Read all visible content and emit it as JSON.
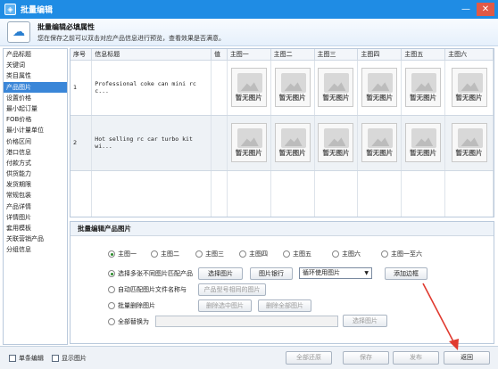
{
  "window": {
    "title": "批量编辑"
  },
  "banner": {
    "title": "批量编辑必填属性",
    "description": "您在保存之前可以双击对应产品信息进行预览，查看效果是否满意。"
  },
  "sidebar": {
    "items": [
      {
        "label": "产品标题"
      },
      {
        "label": "关键词"
      },
      {
        "label": "类目属性"
      },
      {
        "label": "产品图片",
        "active": true
      },
      {
        "label": "设置价格"
      },
      {
        "label": "最小起订量"
      },
      {
        "label": "FOB价格"
      },
      {
        "label": "最小计量单位"
      },
      {
        "label": "价格区间"
      },
      {
        "label": "港口信息"
      },
      {
        "label": "付款方式"
      },
      {
        "label": "供货能力"
      },
      {
        "label": "发货期限"
      },
      {
        "label": "常规包装"
      },
      {
        "label": "产品详情"
      },
      {
        "label": "详情图片"
      },
      {
        "label": "套用模板"
      },
      {
        "label": "关联营销产品"
      },
      {
        "label": "分组信息"
      }
    ]
  },
  "grid": {
    "columns": [
      "序号",
      "信息标题",
      "值",
      "主图一",
      "主图二",
      "主图三",
      "主图四",
      "主图五",
      "主图六"
    ],
    "rows": [
      {
        "index": "1",
        "title": "Professional coke can mini rc c..."
      },
      {
        "index": "2",
        "title": "Hot selling rc car turbo kit wi..."
      }
    ],
    "no_image_label": "暂无图片"
  },
  "panel": {
    "title": "批量编辑产品图片",
    "image_radios": [
      "主图一",
      "主图二",
      "主图三",
      "主图四",
      "主图五",
      "主图六",
      "主图一至六"
    ],
    "options": {
      "select_local": "选择多张不同图片匹配产品",
      "auto_match": "自动匹配图片文件名称与",
      "batch_delete": "批量删除图片",
      "replace_all": "全部替换为"
    },
    "buttons": {
      "choose_image": "选择图片",
      "image_bank": "图片银行",
      "add_border": "添加边框",
      "model_match": "产品型号相同的图片",
      "delete_selected": "删除选中图片",
      "delete_all": "删除全部图片",
      "choose_image2": "选择图片"
    },
    "loop_select": {
      "value": "循环使用图片"
    }
  },
  "footer": {
    "single_edit": "单条编辑",
    "show_images": "显示图片",
    "restore_all": "全部还原",
    "save": "保存",
    "publish": "发布",
    "back": "返回"
  },
  "colors": {
    "titlebar": "#1f8ce4",
    "active_item": "#3a86d8",
    "annotation_arrow": "#e03a2f"
  }
}
